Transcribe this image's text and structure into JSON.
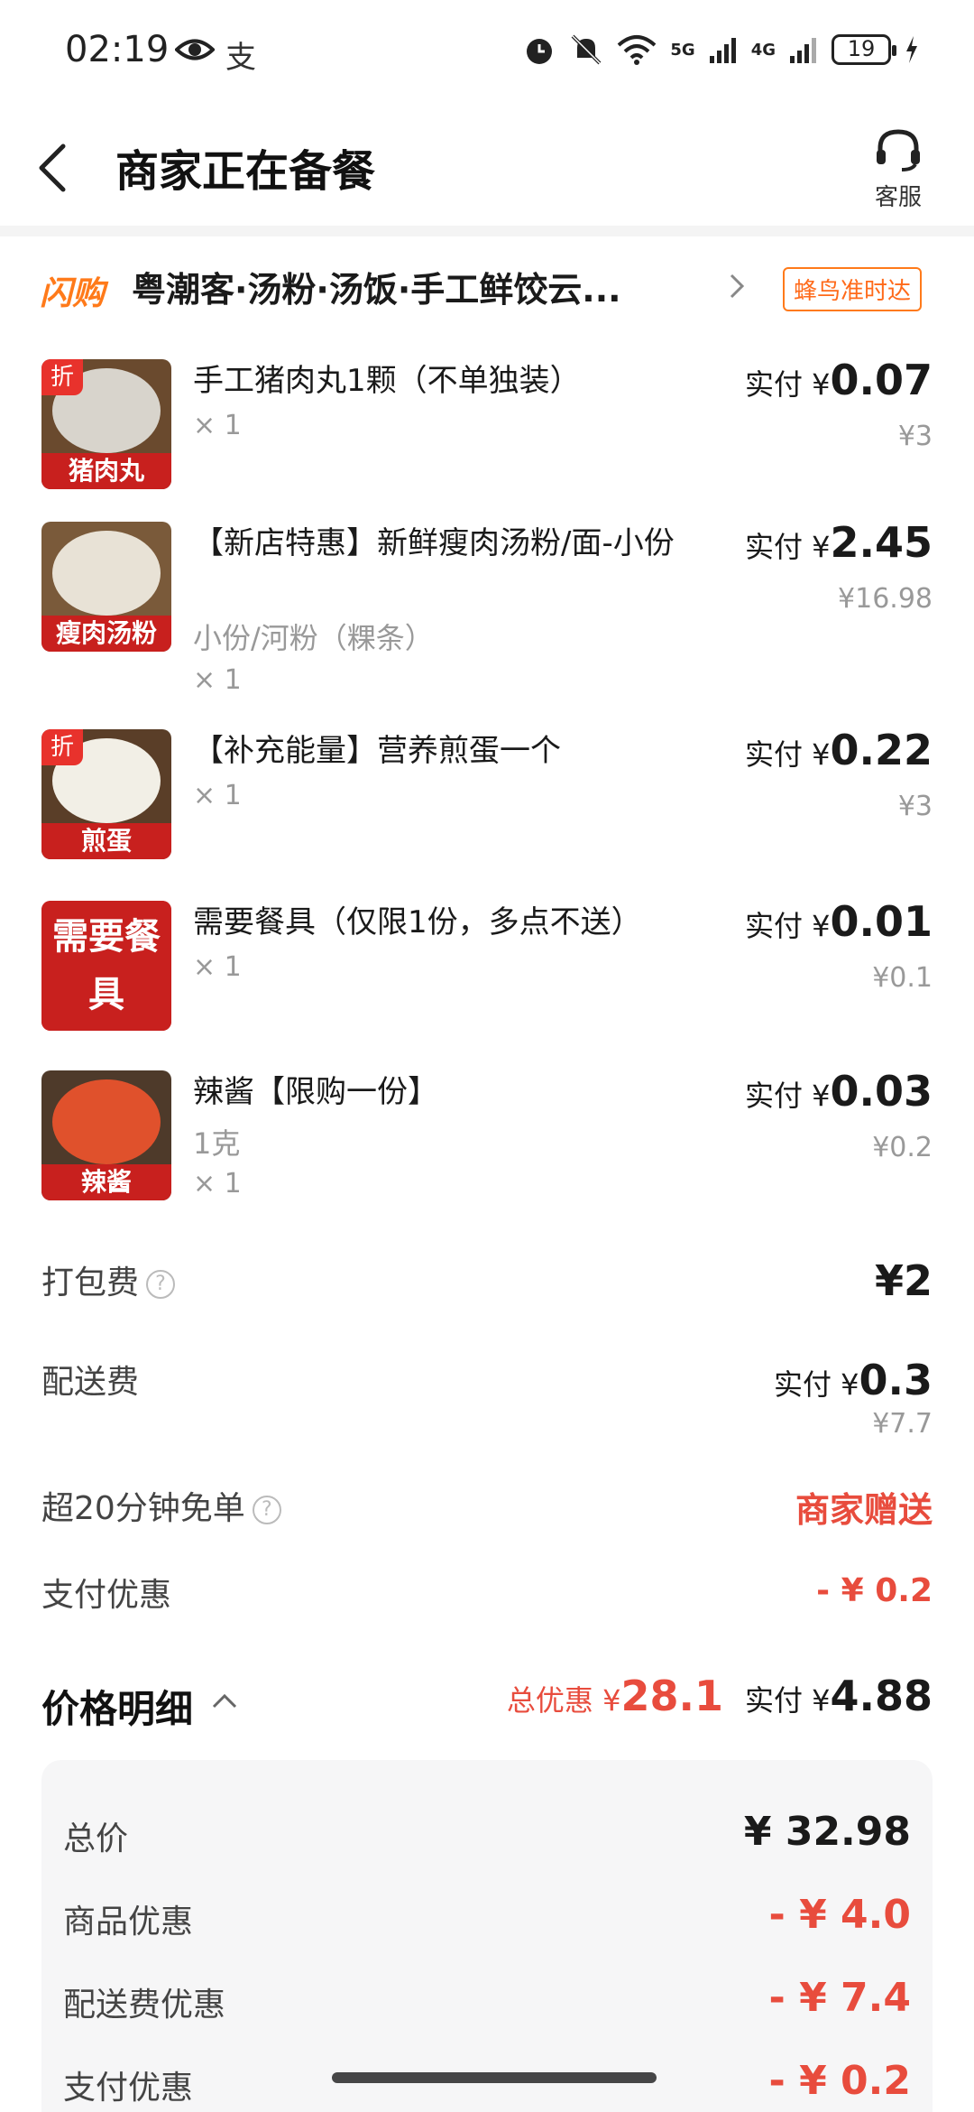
{
  "status_bar": {
    "time": "02:19",
    "pay_icon_text": "支",
    "net_5g": "5G",
    "net_4g": "4G",
    "battery": "19"
  },
  "header": {
    "title": "商家正在备餐",
    "customer_service": "客服"
  },
  "store": {
    "flash_tag": "闪购",
    "name": "粤潮客·汤粉·汤饭·手工鲜饺云...",
    "badge": "蜂鸟准时达"
  },
  "items": [
    {
      "thumb_label": "猪肉丸",
      "discount_tag": "折",
      "name": "手工猪肉丸1颗（不单独装）",
      "spec": "",
      "qty": "× 1",
      "paid_label": "实付 ¥",
      "paid": "0.07",
      "original": "¥3"
    },
    {
      "thumb_label": "瘦肉汤粉",
      "discount_tag": "",
      "name": "【新店特惠】新鲜瘦肉汤粉/面-小份",
      "spec": "小份/河粉（粿条）",
      "qty": "× 1",
      "paid_label": "实付 ¥",
      "paid": "2.45",
      "original": "¥16.98"
    },
    {
      "thumb_label": "煎蛋",
      "discount_tag": "折",
      "name": "【补充能量】营养煎蛋一个",
      "spec": "",
      "qty": "× 1",
      "paid_label": "实付 ¥",
      "paid": "0.22",
      "original": "¥3"
    },
    {
      "thumb_label": "需要餐具",
      "discount_tag": "",
      "name": "需要餐具（仅限1份，多点不送）",
      "spec": "",
      "qty": "× 1",
      "paid_label": "实付 ¥",
      "paid": "0.01",
      "original": "¥0.1"
    },
    {
      "thumb_label": "辣酱",
      "discount_tag": "",
      "name": "辣酱【限购一份】",
      "spec": "1克",
      "qty": "× 1",
      "paid_label": "实付 ¥",
      "paid": "0.03",
      "original": "¥0.2"
    }
  ],
  "fees": {
    "packing": {
      "label": "打包费",
      "value": "¥2"
    },
    "delivery": {
      "label": "配送费",
      "paid_label": "实付 ¥",
      "paid": "0.3",
      "original": "¥7.7"
    },
    "free_if_late": {
      "label": "超20分钟免单",
      "value": "商家赠送"
    },
    "pay_discount": {
      "label": "支付优惠",
      "value": "- ¥ 0.2"
    }
  },
  "price_detail": {
    "title": "价格明细",
    "total_discount_label": "总优惠 ¥",
    "total_discount": "28.1",
    "paid_label": "实付 ¥",
    "paid": "4.88",
    "rows": [
      {
        "label": "总价",
        "value": "¥ 32.98"
      },
      {
        "label": "商品优惠",
        "value": "- ¥ 4.0"
      },
      {
        "label": "配送费优惠",
        "value": "- ¥ 7.4"
      },
      {
        "label": "支付优惠",
        "value": "- ¥ 0.2"
      }
    ]
  },
  "colors": {
    "accent_orange": "#ff7a1a",
    "discount_red": "#e84c3d",
    "thumb_red": "#c8201e"
  }
}
